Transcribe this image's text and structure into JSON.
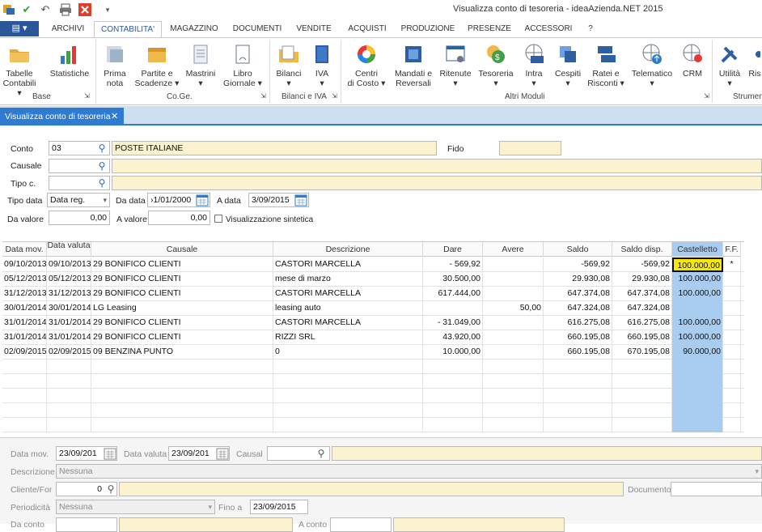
{
  "window": {
    "title": "Visualizza conto di tesoreria - ideaAzienda.NET 2015"
  },
  "ribbon": {
    "file_icon": "app-menu-icon",
    "tabs": [
      "ARCHIVI",
      "CONTABILITA'",
      "MAGAZZINO",
      "DOCUMENTI",
      "VENDITE",
      "ACQUISTI",
      "PRODUZIONE",
      "PRESENZE",
      "ACCESSORI",
      "?"
    ],
    "buttons": {
      "tabelle": "Tabelle\nContabili ▾",
      "statistiche": "Statistiche",
      "prima_nota": "Prima\nnota",
      "partite": "Partite e\nScadenze ▾",
      "mastrini": "Mastrini\n▾",
      "libro": "Libro\nGiornale ▾",
      "bilanci": "Bilanci\n▾",
      "iva": "IVA\n▾",
      "centri": "Centri\ndi Costo ▾",
      "mandati": "Mandati e\nReversali",
      "ritenute": "Ritenute\n▾",
      "tesoreria": "Tesoreria\n▾",
      "intra": "Intra\n▾",
      "cespiti": "Cespiti\n▾",
      "ratei": "Ratei e\nRisconti ▾",
      "telematico": "Telematico\n▾",
      "crm": "CRM",
      "utilita": "Utilità\n▾",
      "ris": "Ris"
    },
    "groups": {
      "base": "Base",
      "coge": "Co.Ge.",
      "bilanci_iva": "Bilanci e IVA",
      "altri": "Altri Moduli",
      "strumenti": "Strumen"
    }
  },
  "doc_tab": {
    "label": "Visualizza conto di tesoreria",
    "close": "✕"
  },
  "form": {
    "conto_label": "Conto",
    "conto_value": "03",
    "conto_desc": "POSTE ITALIANE",
    "fido_label": "Fido",
    "fido_value": "",
    "causale_label": "Causale",
    "causale_value": "",
    "causale_desc": "",
    "tipoc_label": "Tipo c.",
    "tipoc_value": "",
    "tipoc_desc": "",
    "tipodata_label": "Tipo data",
    "tipodata_value": "Data reg.",
    "dadata_label": "Da data",
    "dadata_value": "›1/01/2000",
    "adata_label": "A data",
    "adata_value": "3/09/2015",
    "davalore_label": "Da valore",
    "davalore_value": "0,00",
    "avalore_label": "A valore",
    "avalore_value": "0,00",
    "sintetica_label": "Visualizzazione sintetica"
  },
  "grid": {
    "headers": [
      "Data mov.",
      "Data valuta",
      "Causale",
      "Descrizione",
      "Dare",
      "Avere",
      "Saldo",
      "Saldo disp.",
      "Castelletto",
      "F.F."
    ],
    "rows": [
      [
        "09/10/2013",
        "09/10/2013",
        "29 BONIFICO CLIENTI",
        "CASTORI MARCELLA",
        "- 569,92",
        "",
        "-569,92",
        "-569,92",
        "100.000,00",
        "*"
      ],
      [
        "05/12/2013",
        "05/12/2013",
        "29 BONIFICO CLIENTI",
        "mese di marzo",
        "30.500,00",
        "",
        "29.930,08",
        "29.930,08",
        "100.000,00",
        ""
      ],
      [
        "31/12/2013",
        "31/12/2013",
        "29 BONIFICO CLIENTI",
        "CASTORI MARCELLA",
        "617.444,00",
        "",
        "647.374,08",
        "647.374,08",
        "100.000,00",
        ""
      ],
      [
        "30/01/2014",
        "30/01/2014",
        "LG Leasing",
        "leasing auto",
        "",
        "50,00",
        "647.324,08",
        "647.324,08",
        "",
        ""
      ],
      [
        "31/01/2014",
        "31/01/2014",
        "29 BONIFICO CLIENTI",
        "CASTORI MARCELLA",
        "- 31.049,00",
        "",
        "616.275,08",
        "616.275,08",
        "100.000,00",
        ""
      ],
      [
        "31/01/2014",
        "31/01/2014",
        "29 BONIFICO CLIENTI",
        "RIZZI SRL",
        "43.920,00",
        "",
        "660.195,08",
        "660.195,08",
        "100.000,00",
        ""
      ],
      [
        "02/09/2015",
        "02/09/2015",
        "09 BENZINA PUNTO",
        "0",
        "10.000,00",
        "",
        "660.195,08",
        "670.195,08",
        "90.000,00",
        ""
      ]
    ]
  },
  "bottom": {
    "datamov_label": "Data mov.",
    "datamov_value": "23/09/201",
    "datavaluta_label": "Data valuta",
    "datavaluta_value": "23/09/201",
    "causal_label": "Causal",
    "descrizione_label": "Descrizione",
    "descrizione_value": "Nessuna",
    "cliente_label": "Cliente/For",
    "cliente_value": "0",
    "documento_label": "Documento",
    "periodicita_label": "Periodicità",
    "periodicita_value": "Nessuna",
    "finoa_label": "Fino a",
    "finoa_value": "23/09/2015",
    "dacontro_label": "Da conto",
    "acontro_label": "A conto"
  }
}
